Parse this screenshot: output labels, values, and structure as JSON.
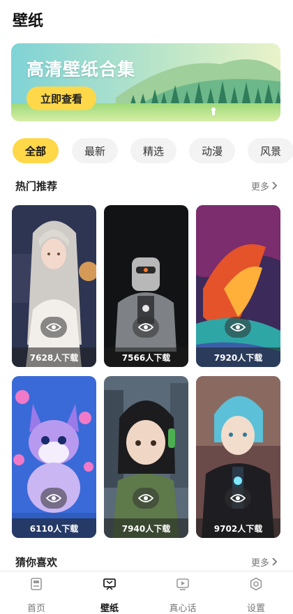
{
  "header": {
    "title": "壁纸"
  },
  "banner": {
    "title": "高清壁纸合集",
    "button_label": "立即查看"
  },
  "categories": {
    "items": [
      "全部",
      "最新",
      "精选",
      "动漫",
      "风景"
    ],
    "active": "全部"
  },
  "hot": {
    "title": "热门推荐",
    "more_label": "更多",
    "items": [
      {
        "downloads": "7628人下载",
        "subject": "anime girl with long silver hair"
      },
      {
        "downloads": "7566人下载",
        "subject": "armored robot"
      },
      {
        "downloads": "7920人下载",
        "subject": "colorful abstract landscape"
      },
      {
        "downloads": "6110人下载",
        "subject": "cute purple fox cub"
      },
      {
        "downloads": "7940人下载",
        "subject": "girl with headphones"
      },
      {
        "downloads": "9702人下载",
        "subject": "blue haired anime boy"
      }
    ]
  },
  "guess": {
    "title": "猜你喜欢",
    "more_label": "更多"
  },
  "tabbar": {
    "items": [
      {
        "label": "首页",
        "icon": "home-icon"
      },
      {
        "label": "壁纸",
        "icon": "wallpaper-icon"
      },
      {
        "label": "真心话",
        "icon": "video-icon"
      },
      {
        "label": "设置",
        "icon": "settings-icon"
      }
    ],
    "active": "壁纸"
  },
  "colors": {
    "accent": "#ffd84a",
    "chip_bg": "#f3f3f3",
    "text_muted": "#777777"
  }
}
